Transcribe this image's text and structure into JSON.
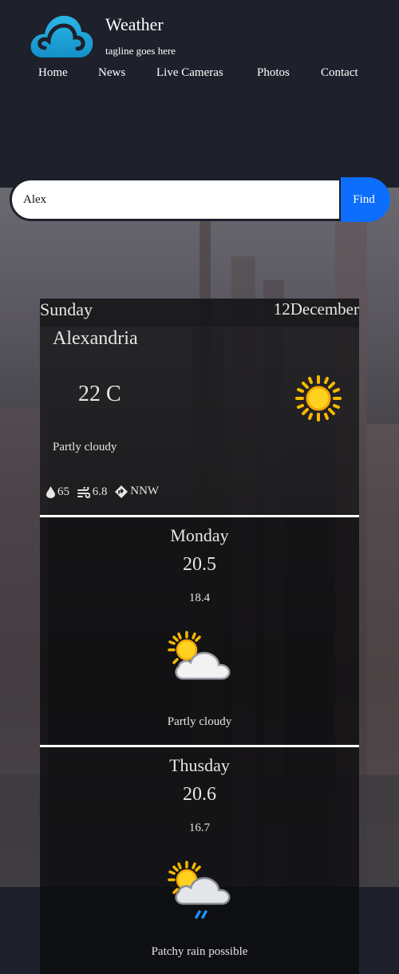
{
  "site": {
    "title": "Weather",
    "tagline": "tagline goes here",
    "logo_icon": "cloud-logo-icon",
    "accent": "#1ea7dc"
  },
  "nav": {
    "items": [
      {
        "label": "Home"
      },
      {
        "label": "News"
      },
      {
        "label": "Live Cameras"
      },
      {
        "label": "Photos"
      },
      {
        "label": "Contact"
      }
    ]
  },
  "search": {
    "value": "Alex",
    "button_label": "Find",
    "button_color": "#0d6efd"
  },
  "today": {
    "day": "Sunday",
    "date": "12December",
    "city": "Alexandria",
    "temp": "22 C",
    "condition": "Partly cloudy",
    "icon": "sun-icon",
    "humidity": "65",
    "wind_speed": "6.8",
    "wind_direction": "NNW"
  },
  "forecast": [
    {
      "day": "Monday",
      "max": "20.5",
      "min": "18.4",
      "condition": "Partly cloudy",
      "icon": "partly-cloudy-icon"
    },
    {
      "day": "Thusday",
      "max": "20.6",
      "min": "16.7",
      "condition": "Patchy rain possible",
      "icon": "patchy-rain-icon"
    }
  ]
}
